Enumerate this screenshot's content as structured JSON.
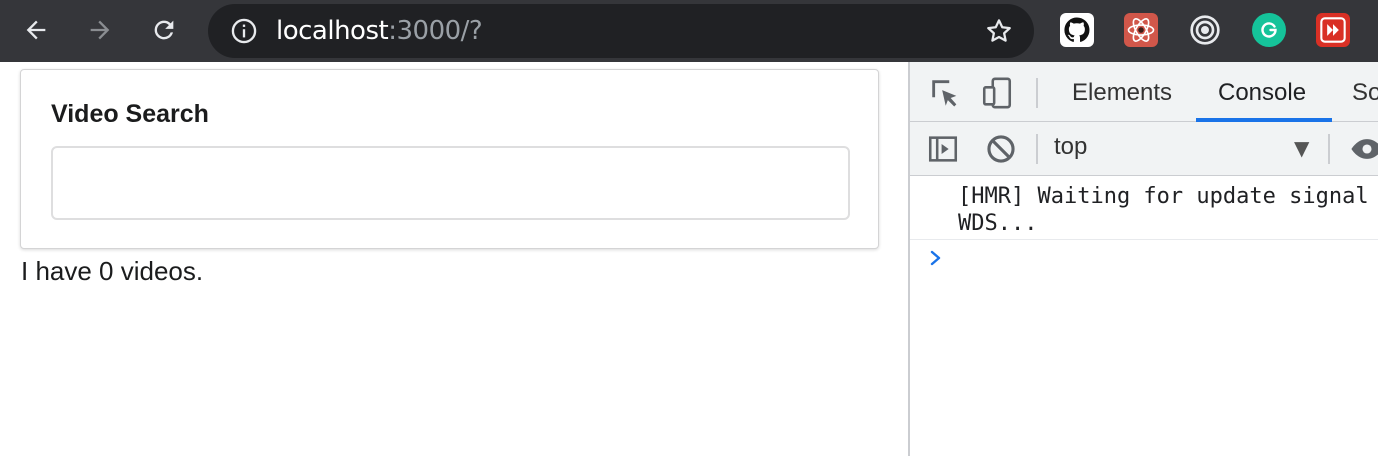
{
  "browser": {
    "url_host": "localhost",
    "url_rest": ":3000/?",
    "icons": {
      "back": "arrow-left-icon",
      "forward": "arrow-right-icon",
      "reload": "reload-icon",
      "info": "info-icon",
      "bookmark": "star-icon"
    },
    "extensions": [
      "github-icon",
      "react-devtools-icon",
      "target-icon",
      "grammarly-icon",
      "red-play-icon"
    ],
    "colors": {
      "toolbar": "#35363a",
      "omnibox": "#202124",
      "grammarly": "#15c39a",
      "react": "#d1574a",
      "red_ext": "#d93025"
    }
  },
  "page": {
    "card_label": "Video Search",
    "search_value": "",
    "video_count_text": "I have 0 videos."
  },
  "devtools": {
    "tabs": [
      "Elements",
      "Console",
      "So"
    ],
    "active_tab": "Console",
    "context": "top",
    "messages": [
      "[HMR] Waiting for update signal\nWDS..."
    ],
    "colors": {
      "active_underline": "#1a73e8",
      "prompt": "#1a73e8"
    }
  }
}
